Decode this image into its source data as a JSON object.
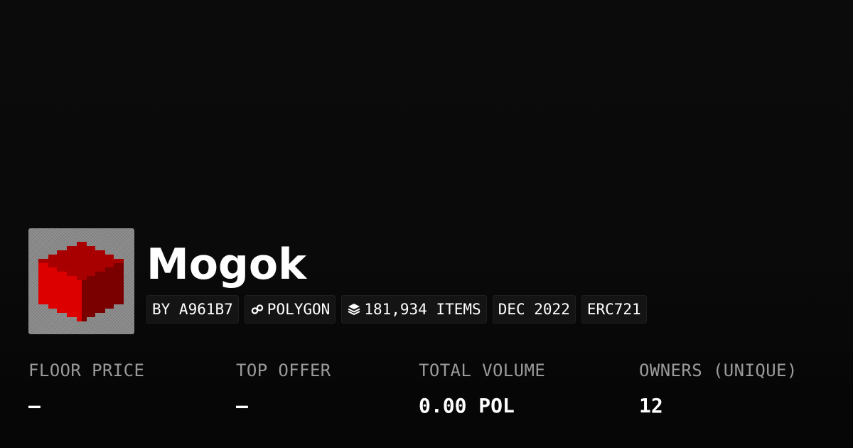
{
  "collection": {
    "name": "Mogok",
    "avatar_icon": "red-cube-icon"
  },
  "chips": {
    "creator": "BY A961B7",
    "chain": "POLYGON",
    "chain_icon": "polygon-link-icon",
    "items": "181,934 ITEMS",
    "items_icon": "layers-icon",
    "created": "DEC 2022",
    "standard": "ERC721"
  },
  "stats": {
    "floor_price": {
      "label": "FLOOR PRICE",
      "value": "—"
    },
    "top_offer": {
      "label": "TOP OFFER",
      "value": "—"
    },
    "total_volume": {
      "label": "TOTAL VOLUME",
      "value": "0.00 POL"
    },
    "owners": {
      "label": "OWNERS (UNIQUE)",
      "value": "12"
    }
  },
  "colors": {
    "background": "#0a0a0a",
    "chip_background": "#141414",
    "label_gray": "#9a9a9a",
    "cube_top": "#a80000",
    "cube_left": "#dd0000",
    "cube_right": "#7a0000"
  }
}
